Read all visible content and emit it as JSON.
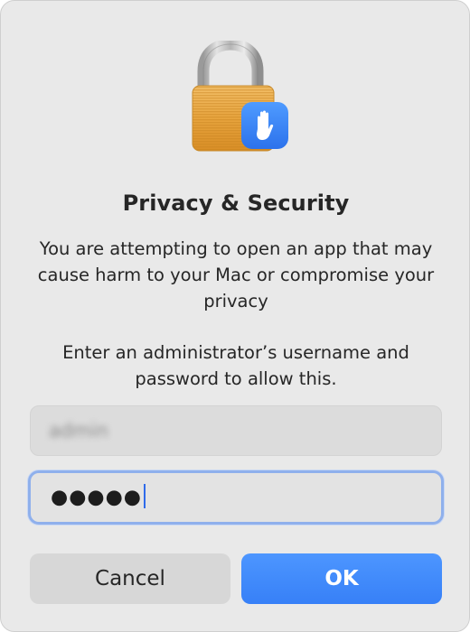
{
  "dialog": {
    "title": "Privacy & Security",
    "message": "You are attempting to open an app that may cause harm to your Mac or compromise your privacy",
    "instructions": "Enter an administrator’s username and password to allow this.",
    "icon": "lock-icon",
    "badge_icon": "hand-stop-icon",
    "username": {
      "value": "admin",
      "obscured": true
    },
    "password": {
      "value": "●●●●●",
      "focused": true
    },
    "buttons": {
      "cancel_label": "Cancel",
      "ok_label": "OK"
    },
    "colors": {
      "accent": "#3780f7",
      "focus_ring": "#8fb0ec",
      "lock_body": "#e6a13a",
      "badge": "#3a84f3"
    }
  }
}
